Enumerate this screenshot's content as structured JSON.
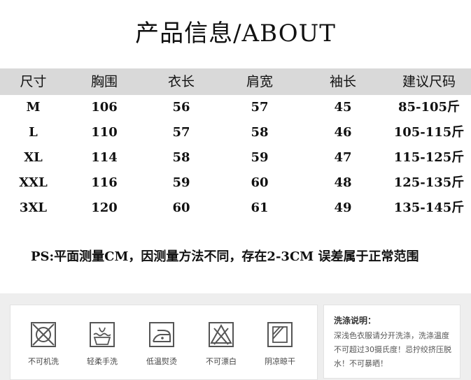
{
  "title": "产品信息/ABOUT",
  "table": {
    "headers": [
      "尺寸",
      "胸围",
      "衣长",
      "肩宽",
      "袖长",
      "建议尺码"
    ],
    "rows": [
      [
        "M",
        "106",
        "56",
        "57",
        "45",
        "85-105斤"
      ],
      [
        "L",
        "110",
        "57",
        "58",
        "46",
        "105-115斤"
      ],
      [
        "XL",
        "114",
        "58",
        "59",
        "47",
        "115-125斤"
      ],
      [
        "XXL",
        "116",
        "59",
        "60",
        "48",
        "125-135斤"
      ],
      [
        "3XL",
        "120",
        "60",
        "61",
        "49",
        "135-145斤"
      ]
    ]
  },
  "note": "PS:平面测量CM，因测量方法不同，存在2-3CM 误差属于正常范围",
  "care": {
    "items": [
      {
        "icon": "no-machine-wash-icon",
        "label": "不可机洗"
      },
      {
        "icon": "gentle-hand-wash-icon",
        "label": "轻柔手洗"
      },
      {
        "icon": "low-temp-iron-icon",
        "label": "低温熨烫"
      },
      {
        "icon": "no-bleach-icon",
        "label": "不可漂白"
      },
      {
        "icon": "shade-dry-icon",
        "label": "阴凉晾干"
      }
    ],
    "wash_title": "洗涤说明：",
    "wash_text": "深浅色衣服请分开洗涤，洗涤温度不可超过30摄氏度！忌拧绞挤压脱水！不可暴晒！"
  }
}
